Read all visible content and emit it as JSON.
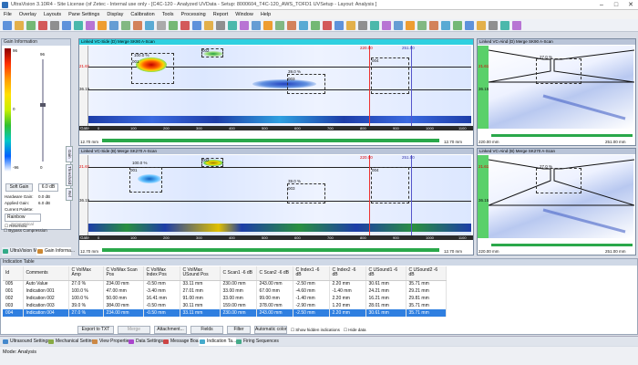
{
  "app": {
    "title": "UltraVision 3.10R4 - Site License (of Zetec - Internal use only - [C4C-120 - Analyzed UVData - Setup: 8000604_T4C-120_AWS_TOFD1 UVSetup - Layout: Analysis ]"
  },
  "window_controls": {
    "minimize": "–",
    "maximize": "□",
    "close": "✕"
  },
  "menu": [
    "File",
    "Overlay",
    "Layouts",
    "Pane Settings",
    "Display",
    "Calibration",
    "Tools",
    "Processing",
    "Report",
    "Window",
    "Help"
  ],
  "gain": {
    "title": "Gain Information",
    "scale_top": "96",
    "scale_mid": "0",
    "scale_bottom": "-96",
    "right_top": "96",
    "right_bottom": "0",
    "soft_gain_button": "Soft Gain",
    "soft_gain_value": "6.0 dB",
    "hardware_gain_label": "Hardware Gain:",
    "hardware_gain_value": "0.0 dB",
    "applied_gain_label": "Applied Gain:",
    "applied_gain_value": "6.0 dB",
    "palette_label": "Current Palette:",
    "palette_value": "Rainbow",
    "reversed": "Reversed",
    "symmetrical": "Symmetrical",
    "bypass": "Bypass Compression",
    "side_tabs": [
      "Gain",
      "Threshold",
      "Ref"
    ]
  },
  "scan_top": {
    "title": "Linked VC-Side (D) Merge SK90 A-Scan",
    "left_ruler": "Gate",
    "bottom_left": "12.70 mm",
    "bottom_right": "12.70 mm",
    "depth1": "21.61",
    "depth2": "36.15",
    "cursor1": "220.00",
    "cursor2": "251.00",
    "box1": "100.0 %",
    "box1_id": "001",
    "box2": "39.0 %",
    "box2_id": "003",
    "box3_id": "002",
    "box4_id": "004",
    "ticks": [
      "0",
      "100",
      "200",
      "300",
      "400",
      "500",
      "600",
      "700",
      "800",
      "900",
      "1000",
      "1100"
    ]
  },
  "scan_bottom": {
    "title": "Linked VC-Side (B) Merge SK270 A-Scan",
    "left_ruler": "Gate",
    "bottom_left": "12.70 mm",
    "bottom_right": "12.70 mm",
    "depth1": "21.61",
    "depth2": "36.15",
    "cursor1": "220.00",
    "cursor2": "251.00",
    "box1": "100.0 %",
    "box1_id": "001",
    "box2": "39.0 %",
    "box2_id": "003",
    "box3_id": "002",
    "box4_id": "004",
    "ticks": [
      "0",
      "100",
      "200",
      "300",
      "400",
      "500",
      "600",
      "700",
      "800",
      "900",
      "1000",
      "1100"
    ]
  },
  "side_top": {
    "title": "Linked VC-Aind (D) Merge SK90 A-Scan",
    "pct": "27.0 %",
    "depth1": "21.61",
    "depth2": "36.15",
    "bottom_left": "220.00 mm",
    "bottom_right": "251.00 mm"
  },
  "side_bottom": {
    "title": "Linked VC-Aind (B) Merge SK270 A-Scan",
    "pct": "27.0 %",
    "depth1": "21.61",
    "depth2": "36.15",
    "bottom_left": "220.00 mm",
    "bottom_right": "251.00 mm"
  },
  "bottom_tabs_left": [
    "UltraVision M...",
    "Gain Informa..."
  ],
  "indication_table": {
    "title": "Indication Table",
    "headers": [
      "Id",
      "Comments",
      "C VolMax Amp",
      "C VolMax Scan Pos",
      "C VolMax Index Pos",
      "C VolMax USound Pos",
      "C Scan1 -6 dB",
      "C Scan2 -6 dB",
      "C Index1 -6 dB",
      "C Index2 -6 dB",
      "C USound1 -6 dB",
      "C USound2 -6 dB"
    ],
    "rows": [
      [
        "005",
        "Auto Value",
        "27.0 %",
        "234.00 mm",
        "-0.50 mm",
        "33.11 mm",
        "230.00 mm",
        "243.00 mm",
        "-2.50 mm",
        "2.20 mm",
        "30.61 mm",
        "35.71 mm"
      ],
      [
        "001",
        "Indication 001",
        "100.0 %",
        "47.00 mm",
        "-3.40 mm",
        "27.01 mm",
        "33.00 mm",
        "67.00 mm",
        "-4.60 mm",
        "-1.40 mm",
        "24.21 mm",
        "29.21 mm"
      ],
      [
        "002",
        "Indication 002",
        "100.0 %",
        "50.00 mm",
        "16.41 mm",
        "91.00 mm",
        "33.00 mm",
        "99.00 mm",
        "-1.40 mm",
        "2.20 mm",
        "16.21 mm",
        "29.81 mm"
      ],
      [
        "003",
        "Indication 003",
        "39.0 %",
        "384.00 mm",
        "-0.50 mm",
        "30.11 mm",
        "159.00 mm",
        "378.00 mm",
        "-2.90 mm",
        "1.20 mm",
        "28.01 mm",
        "35.71 mm"
      ],
      [
        "004",
        "Indication 004",
        "27.0 %",
        "234.00 mm",
        "-0.50 mm",
        "33.11 mm",
        "230.00 mm",
        "243.00 mm",
        "-2.50 mm",
        "2.20 mm",
        "30.61 mm",
        "35.71 mm"
      ]
    ],
    "selected_row": 4
  },
  "buttons": {
    "export": "Export to TXT",
    "merge": "Merge",
    "attachment": "Attachment...",
    "fields": "Fields",
    "filter": "Filter",
    "auto_color": "Automatic color",
    "show_hidden": "Show hidden indications",
    "hide_data": "Hide data"
  },
  "bottom_tabs": [
    "Ultrasound Settings",
    "Mechanical Settings",
    "View Properties",
    "Data Settings",
    "Message Board",
    "Indication Ta...",
    "Firing Sequences"
  ],
  "status": {
    "mode": "Mode: Analysis"
  }
}
